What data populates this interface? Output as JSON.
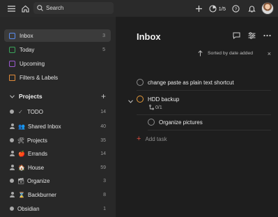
{
  "topbar": {
    "search_placeholder": "Search",
    "progress": "1/5"
  },
  "nav": [
    {
      "label": "Inbox",
      "count": "3",
      "icon": "inbox-icon",
      "color": "#5b8def",
      "active": true
    },
    {
      "label": "Today",
      "count": "5",
      "icon": "calendar-today-icon",
      "color": "#3aa45a"
    },
    {
      "label": "Upcoming",
      "count": "",
      "icon": "calendar-upcoming-icon",
      "color": "#9b59d0"
    },
    {
      "label": "Filters & Labels",
      "count": "",
      "icon": "filters-icon",
      "color": "#e08a3a"
    }
  ],
  "projects_header": "Projects",
  "projects": [
    {
      "label": "TODO",
      "count": "14",
      "marker": "dot",
      "emoji": "✓"
    },
    {
      "label": "Shared Inbox",
      "count": "40",
      "marker": "person",
      "emoji": "👥"
    },
    {
      "label": "Projects",
      "count": "35",
      "marker": "dot",
      "emoji": "🛠"
    },
    {
      "label": "Errands",
      "count": "14",
      "marker": "person",
      "emoji": "🍎"
    },
    {
      "label": "House",
      "count": "59",
      "marker": "person",
      "emoji": "🏠"
    },
    {
      "label": "Organize",
      "count": "3",
      "marker": "dot",
      "emoji": "🗃"
    },
    {
      "label": "Backburner",
      "count": "8",
      "marker": "person",
      "emoji": "⌛"
    },
    {
      "label": "Obsidian",
      "count": "1",
      "marker": "dot",
      "emoji": ""
    }
  ],
  "main": {
    "title": "Inbox",
    "sort_label": "Sorted by date added",
    "tasks": [
      {
        "text": "change paste as plain text shortcut"
      },
      {
        "text": "HDD backup",
        "subtasks": "0/1"
      },
      {
        "text": "Organize pictures"
      }
    ],
    "add_task": "Add task"
  },
  "colors": {
    "accent": "#dc4c3e",
    "priority_orange": "#e59a3a"
  }
}
